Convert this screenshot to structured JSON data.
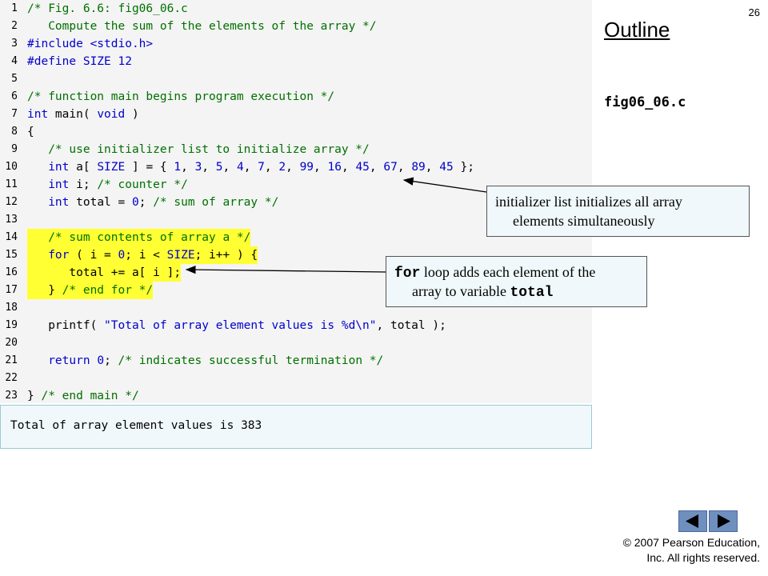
{
  "slide_number": "26",
  "outline_title": "Outline",
  "file_name": "fig06_06.c",
  "code_lines": [
    {
      "n": "1",
      "parts": [
        {
          "t": "/* Fig. 6.6: fig06_06.c",
          "c": "green"
        }
      ]
    },
    {
      "n": "2",
      "parts": [
        {
          "t": "   Compute the sum of the elements of the array */",
          "c": "green"
        }
      ]
    },
    {
      "n": "3",
      "parts": [
        {
          "t": "#include <stdio.h>",
          "c": "blue"
        }
      ]
    },
    {
      "n": "4",
      "parts": [
        {
          "t": "#define ",
          "c": "blue"
        },
        {
          "t": "SIZE 12",
          "c": "blue"
        }
      ]
    },
    {
      "n": "5",
      "parts": []
    },
    {
      "n": "6",
      "parts": [
        {
          "t": "/* function main begins program execution */",
          "c": "green"
        }
      ]
    },
    {
      "n": "7",
      "parts": [
        {
          "t": "int ",
          "c": "blue"
        },
        {
          "t": "main( ",
          "c": ""
        },
        {
          "t": "void",
          "c": "blue"
        },
        {
          "t": " )",
          "c": ""
        }
      ]
    },
    {
      "n": "8",
      "parts": [
        {
          "t": "{",
          "c": ""
        }
      ]
    },
    {
      "n": "9",
      "parts": [
        {
          "t": "   /* use initializer list to initialize array */",
          "c": "green"
        }
      ]
    },
    {
      "n": "10",
      "parts": [
        {
          "t": "   ",
          "c": ""
        },
        {
          "t": "int",
          "c": "blue"
        },
        {
          "t": " a[ ",
          "c": ""
        },
        {
          "t": "SIZE",
          "c": "blue"
        },
        {
          "t": " ] = { ",
          "c": ""
        },
        {
          "t": "1",
          "c": "blue"
        },
        {
          "t": ", ",
          "c": ""
        },
        {
          "t": "3",
          "c": "blue"
        },
        {
          "t": ", ",
          "c": ""
        },
        {
          "t": "5",
          "c": "blue"
        },
        {
          "t": ", ",
          "c": ""
        },
        {
          "t": "4",
          "c": "blue"
        },
        {
          "t": ", ",
          "c": ""
        },
        {
          "t": "7",
          "c": "blue"
        },
        {
          "t": ", ",
          "c": ""
        },
        {
          "t": "2",
          "c": "blue"
        },
        {
          "t": ", ",
          "c": ""
        },
        {
          "t": "99",
          "c": "blue"
        },
        {
          "t": ", ",
          "c": ""
        },
        {
          "t": "16",
          "c": "blue"
        },
        {
          "t": ", ",
          "c": ""
        },
        {
          "t": "45",
          "c": "blue"
        },
        {
          "t": ", ",
          "c": ""
        },
        {
          "t": "67",
          "c": "blue"
        },
        {
          "t": ", ",
          "c": ""
        },
        {
          "t": "89",
          "c": "blue"
        },
        {
          "t": ", ",
          "c": ""
        },
        {
          "t": "45",
          "c": "blue"
        },
        {
          "t": " };",
          "c": ""
        }
      ]
    },
    {
      "n": "11",
      "parts": [
        {
          "t": "   ",
          "c": ""
        },
        {
          "t": "int",
          "c": "blue"
        },
        {
          "t": " i; ",
          "c": ""
        },
        {
          "t": "/* counter */",
          "c": "green"
        }
      ]
    },
    {
      "n": "12",
      "parts": [
        {
          "t": "   ",
          "c": ""
        },
        {
          "t": "int",
          "c": "blue"
        },
        {
          "t": " total = ",
          "c": ""
        },
        {
          "t": "0",
          "c": "blue"
        },
        {
          "t": "; ",
          "c": ""
        },
        {
          "t": "/* sum of array */",
          "c": "green"
        }
      ]
    },
    {
      "n": "13",
      "parts": []
    },
    {
      "n": "14",
      "hl": true,
      "parts": [
        {
          "t": "   ",
          "c": ""
        },
        {
          "t": "/* sum contents of array a */",
          "c": "green"
        }
      ]
    },
    {
      "n": "15",
      "hl": true,
      "parts": [
        {
          "t": "   ",
          "c": ""
        },
        {
          "t": "for",
          "c": "blue"
        },
        {
          "t": " ( i = ",
          "c": ""
        },
        {
          "t": "0",
          "c": "blue"
        },
        {
          "t": "; i < ",
          "c": ""
        },
        {
          "t": "SIZE",
          "c": "blue"
        },
        {
          "t": "; i++ ) {",
          "c": ""
        }
      ]
    },
    {
      "n": "16",
      "hl": true,
      "parts": [
        {
          "t": "      total += a[ i ];",
          "c": ""
        }
      ]
    },
    {
      "n": "17",
      "hl": true,
      "parts": [
        {
          "t": "   } ",
          "c": ""
        },
        {
          "t": "/* end for */",
          "c": "green"
        }
      ]
    },
    {
      "n": "18",
      "parts": []
    },
    {
      "n": "19",
      "parts": [
        {
          "t": "   printf( ",
          "c": ""
        },
        {
          "t": "\"Total of array element values is %d\\n\"",
          "c": "blue"
        },
        {
          "t": ", total );",
          "c": ""
        }
      ]
    },
    {
      "n": "20",
      "parts": []
    },
    {
      "n": "21",
      "parts": [
        {
          "t": "   ",
          "c": ""
        },
        {
          "t": "return",
          "c": "blue"
        },
        {
          "t": " ",
          "c": ""
        },
        {
          "t": "0",
          "c": "blue"
        },
        {
          "t": "; ",
          "c": ""
        },
        {
          "t": "/* indicates successful termination */",
          "c": "green"
        }
      ]
    },
    {
      "n": "22",
      "parts": []
    },
    {
      "n": "23",
      "parts": [
        {
          "t": "} ",
          "c": ""
        },
        {
          "t": "/* end main */",
          "c": "green"
        }
      ]
    }
  ],
  "output_text": "Total of array element values is 383",
  "callout_initializer": {
    "line1": "initializer list initializes all array",
    "line2": "elements simultaneously"
  },
  "callout_for": {
    "keyword": "for",
    "line1_rest": " loop adds each element of the",
    "line2_prefix": "array to variable ",
    "line2_code": "total"
  },
  "nav": {
    "prev_icon": "triangle-left-icon",
    "next_icon": "triangle-right-icon"
  },
  "copyright_line1": "© 2007 Pearson Education,",
  "copyright_line2": "Inc.  All rights reserved.",
  "colors": {
    "highlight": "#ffff33",
    "keyword": "#0000cc",
    "comment": "#007000",
    "nav_button": "#6f8fbf"
  }
}
